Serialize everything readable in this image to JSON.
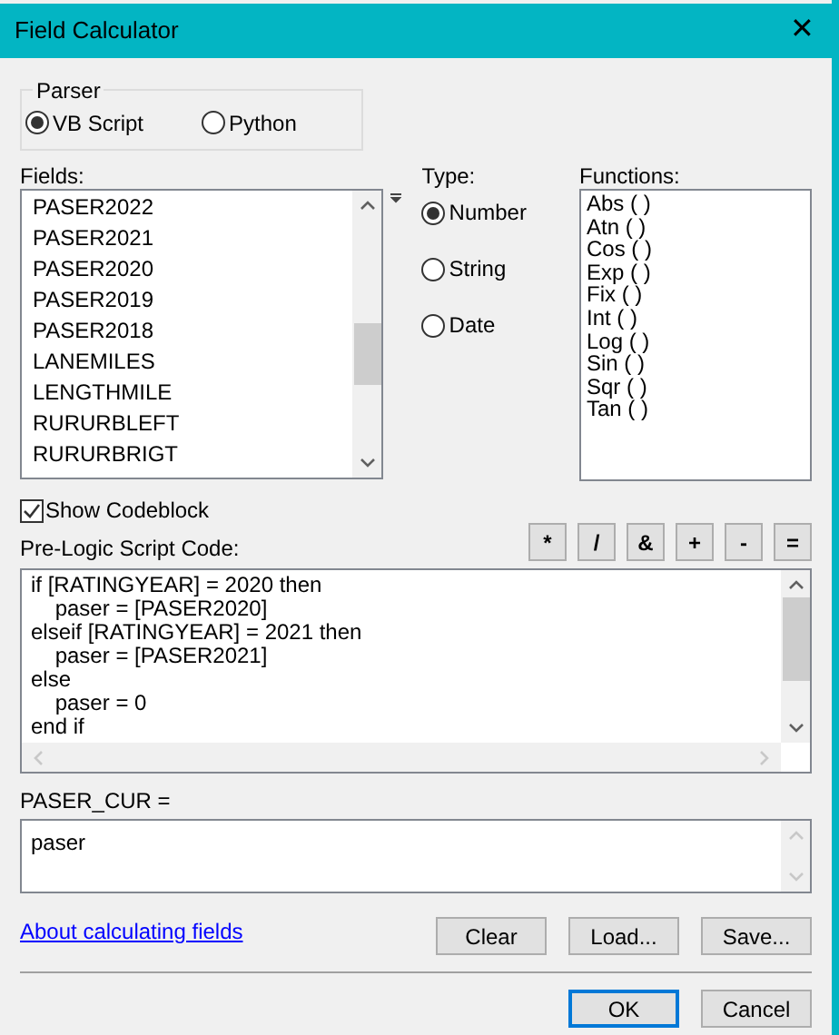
{
  "window": {
    "title": "Field Calculator",
    "close": "✕"
  },
  "parser": {
    "label": "Parser",
    "options": [
      {
        "label": "VB Script",
        "selected": true
      },
      {
        "label": "Python",
        "selected": false
      }
    ]
  },
  "fields": {
    "label": "Fields:",
    "items": [
      "PASER2022",
      "PASER2021",
      "PASER2020",
      "PASER2019",
      "PASER2018",
      "LANEMILES",
      "LENGTHMILE",
      "RURURBLEFT",
      "RURURBRIGT"
    ]
  },
  "type": {
    "label": "Type:",
    "options": [
      {
        "label": "Number",
        "selected": true
      },
      {
        "label": "String",
        "selected": false
      },
      {
        "label": "Date",
        "selected": false
      }
    ]
  },
  "functions": {
    "label": "Functions:",
    "items": [
      "Abs ( )",
      "Atn ( )",
      "Cos ( )",
      "Exp ( )",
      "Fix ( )",
      "Int ( )",
      "Log ( )",
      "Sin ( )",
      "Sqr ( )",
      "Tan ( )"
    ]
  },
  "show_codeblock": {
    "label": "Show Codeblock",
    "checked": true
  },
  "operators": [
    "*",
    "/",
    "&",
    "+",
    "-",
    "="
  ],
  "pre_logic": {
    "label": "Pre-Logic Script Code:",
    "lines": [
      "if [RATINGYEAR] = 2020 then",
      "    paser = [PASER2020]",
      "elseif [RATINGYEAR] = 2021 then",
      "    paser = [PASER2021]",
      "else",
      "    paser = 0",
      "end if"
    ]
  },
  "expression": {
    "label": "PASER_CUR =",
    "value": "paser"
  },
  "help_link": "About calculating fields",
  "buttons": [
    "Clear",
    "Load...",
    "Save..."
  ],
  "footer_buttons": [
    {
      "label": "OK",
      "default": true
    },
    {
      "label": "Cancel",
      "default": false
    }
  ]
}
